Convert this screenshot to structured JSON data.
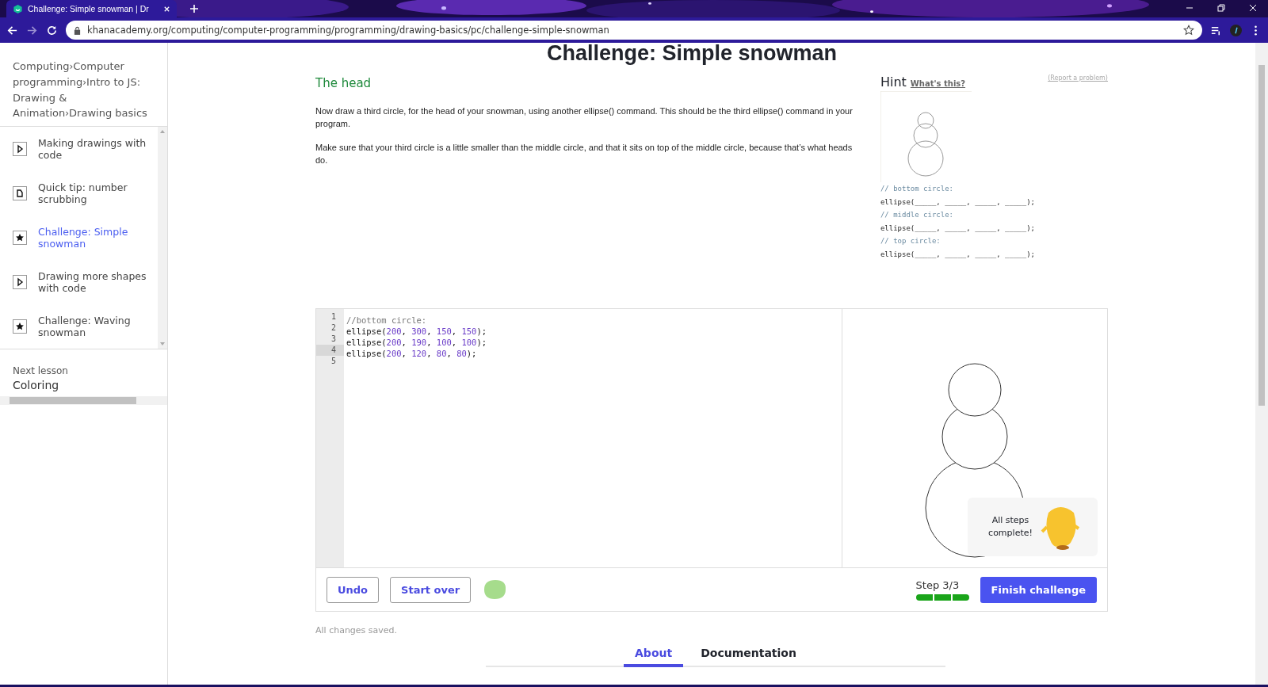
{
  "browser": {
    "tab_title": "Challenge: Simple snowman | Dr",
    "url": "khanacademy.org/computing/computer-programming/programming/drawing-basics/pc/challenge-simple-snowman"
  },
  "sidebar": {
    "breadcrumbs": [
      "Computing",
      "Computer programming",
      "Intro to JS: Drawing & Animation",
      "Drawing basics"
    ],
    "separator": "›",
    "items": [
      {
        "label": "Making drawings with code",
        "kind": "video",
        "selected": false
      },
      {
        "label": "Quick tip: number scrubbing",
        "kind": "article",
        "selected": false
      },
      {
        "label": "Challenge: Simple snowman",
        "kind": "challenge",
        "selected": true
      },
      {
        "label": "Drawing more shapes with code",
        "kind": "video",
        "selected": false
      },
      {
        "label": "Challenge: Waving snowman",
        "kind": "challenge",
        "selected": false
      }
    ],
    "next_label": "Next lesson",
    "next_title": "Coloring"
  },
  "page_title": "Challenge: Simple snowman",
  "step": {
    "heading": "The head",
    "paragraphs": [
      "Now draw a third circle, for the head of your snowman, using another ellipse() command. This should be the third ellipse() command in your program.",
      "Make sure that your third circle is a little smaller than the middle circle, and that it sits on top of the middle circle, because that’s what heads do."
    ]
  },
  "hint": {
    "title": "Hint",
    "link": "What's this?",
    "report": "(Report a problem)",
    "lines": [
      {
        "text": "// bottom circle:",
        "kind": "comment"
      },
      {
        "text": "ellipse(_____, _____, _____, _____);",
        "kind": "code"
      },
      {
        "text": "// middle circle:",
        "kind": "comment"
      },
      {
        "text": "ellipse(_____, _____, _____, _____);",
        "kind": "code"
      },
      {
        "text": "// top circle:",
        "kind": "comment"
      },
      {
        "text": "ellipse(_____, _____, _____, _____);",
        "kind": "code"
      }
    ]
  },
  "editor": {
    "lines": [
      {
        "number": "1",
        "active": false,
        "tokens": [
          {
            "text": "//bottom circle:",
            "kind": "comment"
          }
        ]
      },
      {
        "number": "2",
        "active": false,
        "tokens": [
          {
            "text": "ellipse(",
            "kind": "plain"
          },
          {
            "text": "200",
            "kind": "number"
          },
          {
            "text": ", ",
            "kind": "plain"
          },
          {
            "text": "300",
            "kind": "number"
          },
          {
            "text": ", ",
            "kind": "plain"
          },
          {
            "text": "150",
            "kind": "number"
          },
          {
            "text": ", ",
            "kind": "plain"
          },
          {
            "text": "150",
            "kind": "number"
          },
          {
            "text": ");",
            "kind": "plain"
          }
        ]
      },
      {
        "number": "3",
        "active": false,
        "tokens": [
          {
            "text": "ellipse(",
            "kind": "plain"
          },
          {
            "text": "200",
            "kind": "number"
          },
          {
            "text": ", ",
            "kind": "plain"
          },
          {
            "text": "190",
            "kind": "number"
          },
          {
            "text": ", ",
            "kind": "plain"
          },
          {
            "text": "100",
            "kind": "number"
          },
          {
            "text": ", ",
            "kind": "plain"
          },
          {
            "text": "100",
            "kind": "number"
          },
          {
            "text": ");",
            "kind": "plain"
          }
        ]
      },
      {
        "number": "4",
        "active": true,
        "tokens": [
          {
            "text": "ellipse(",
            "kind": "plain"
          },
          {
            "text": "200",
            "kind": "number"
          },
          {
            "text": ", ",
            "kind": "plain"
          },
          {
            "text": "120",
            "kind": "number"
          },
          {
            "text": ", ",
            "kind": "plain"
          },
          {
            "text": "80",
            "kind": "number"
          },
          {
            "text": ", ",
            "kind": "plain"
          },
          {
            "text": "80",
            "kind": "number"
          },
          {
            "text": ");",
            "kind": "plain"
          }
        ]
      },
      {
        "number": "5",
        "active": false
      }
    ]
  },
  "toast": "All steps complete!",
  "buttons": {
    "undo": "Undo",
    "start_over": "Start over",
    "finish": "Finish challenge"
  },
  "progress": {
    "label": "Step 3/3",
    "segments": [
      {
        "done": true
      },
      {
        "done": true
      },
      {
        "done": true
      }
    ]
  },
  "saved": "All changes saved.",
  "tabs": [
    {
      "label": "About",
      "selected": true
    },
    {
      "label": "Documentation",
      "selected": false
    }
  ]
}
